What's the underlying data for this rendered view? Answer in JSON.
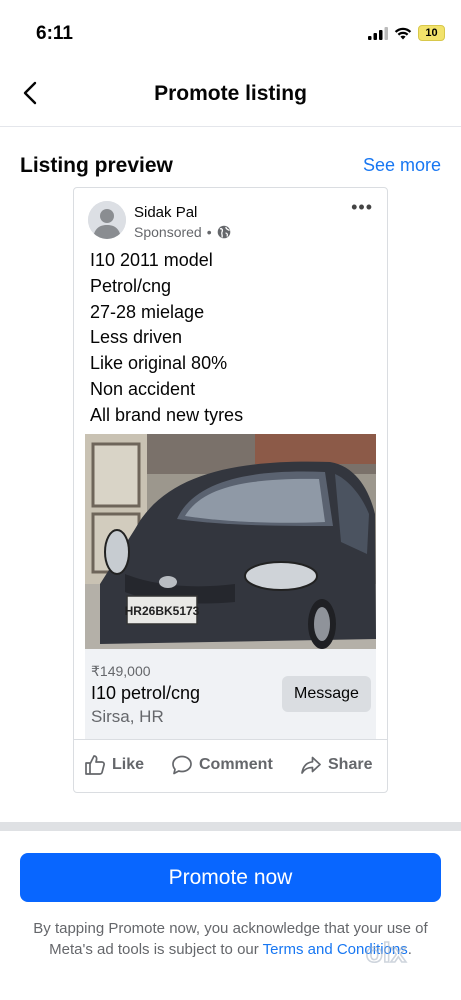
{
  "status_bar": {
    "time": "6:11",
    "battery": "10"
  },
  "nav": {
    "title": "Promote listing",
    "back_icon": "chevron-left-icon"
  },
  "section": {
    "title": "Listing preview",
    "see_more": "See more"
  },
  "post": {
    "poster_name": "Sidak Pal",
    "sponsored": "Sponsored",
    "separator": "•",
    "more": "•••",
    "description_lines": [
      "I10  2011 model",
      "Petrol/cng",
      "27-28 mielage",
      "Less driven",
      "Like original 80%",
      "Non accident",
      "All brand new tyres"
    ],
    "plate": "HR26BK5173",
    "listing": {
      "price": "₹149,000",
      "title": "I10 petrol/cng",
      "location": "Sirsa, HR",
      "message_button": "Message"
    },
    "actions": {
      "like": "Like",
      "comment": "Comment",
      "share": "Share"
    }
  },
  "promote_button": "Promote now",
  "legal": {
    "prefix": "By tapping Promote now, you acknowledge that your use of Meta's ad tools is subject to our ",
    "link": "Terms and Conditions",
    "suffix": "."
  },
  "watermark": "olx",
  "colors": {
    "accent": "#0866ff",
    "link": "#1877f2",
    "muted": "#65676b"
  }
}
